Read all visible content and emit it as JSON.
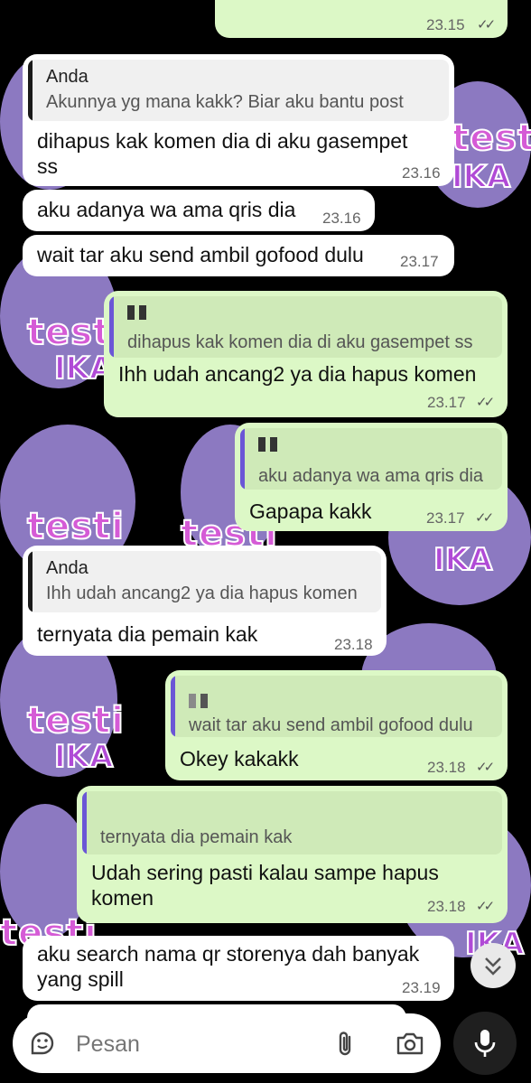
{
  "top_partial_time": "23.15",
  "messages": [
    {
      "quote_name": "Anda",
      "quote_text": "Akunnya yg mana kakk? Biar aku bantu post",
      "text_l1": "dihapus kak komen dia di aku gasempet",
      "text_l2": "ss",
      "time": "23.16"
    },
    {
      "text": "aku adanya wa ama qris dia",
      "time": "23.16"
    },
    {
      "text": "wait tar aku send ambil gofood dulu",
      "time": "23.17"
    },
    {
      "quote_text": "dihapus kak komen dia di aku gasempet ss",
      "text": "Ihh udah ancang2 ya dia hapus komen",
      "time": "23.17"
    },
    {
      "quote_text": "aku adanya wa ama qris dia",
      "text": "Gapapa kakk",
      "time": "23.17"
    },
    {
      "quote_name": "Anda",
      "quote_text": "Ihh udah ancang2 ya dia hapus komen",
      "text": "ternyata dia pemain kak",
      "time": "23.18"
    },
    {
      "quote_text": "wait tar aku send ambil gofood dulu",
      "text": "Okey kakakk",
      "time": "23.18"
    },
    {
      "quote_text": "ternyata dia pemain kak",
      "text_l1": "Udah sering pasti kalau sampe hapus",
      "text_l2": "komen",
      "time": "23.18"
    },
    {
      "text_l1": "aku search nama qr storenya dah banyak",
      "text_l2": "yang spill",
      "time": "23.19"
    }
  ],
  "input": {
    "placeholder": "Pesan"
  },
  "icons": {
    "emoji": "sticker-icon",
    "attach": "paperclip-icon",
    "camera": "camera-icon",
    "mic": "microphone-icon",
    "scroll": "chevrons-down-icon"
  },
  "wallpaper": {
    "text_a": "testi",
    "text_b": "IKA"
  },
  "colors": {
    "incoming": "#ffffff",
    "outgoing": "#dcf8c6",
    "reply_bar": "#6b56d6",
    "wallpaper_bg": "#000000",
    "wallpaper_blob": "#9b86d6"
  }
}
